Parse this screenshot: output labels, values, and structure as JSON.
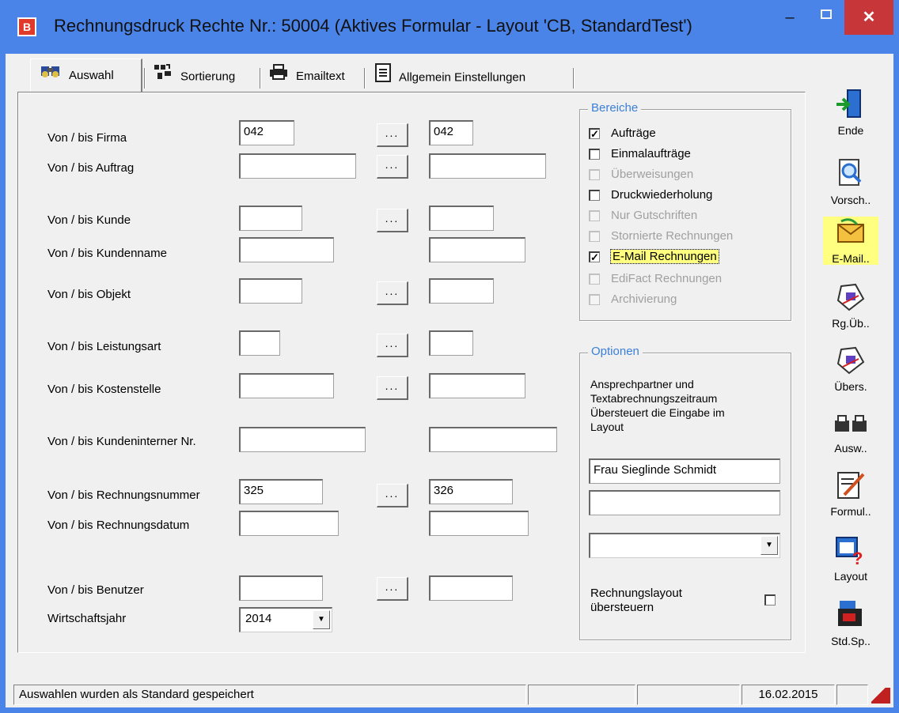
{
  "window": {
    "title": "Rechnungsdruck Rechte Nr.: 50004  (Aktives Formular - Layout 'CB, StandardTest')",
    "minimize": "–",
    "close": "✕"
  },
  "tabs": [
    {
      "label": "Auswahl",
      "icon": "binoculars-icon"
    },
    {
      "label": "Sortierung",
      "icon": "sort-icon"
    },
    {
      "label": "Emailtext",
      "icon": "printer-icon"
    },
    {
      "label": "Allgemein Einstellungen",
      "icon": "document-icon"
    }
  ],
  "form": {
    "firma": {
      "label": "Von / bis Firma",
      "from": "042",
      "to": "042"
    },
    "auftrag": {
      "label": "Von / bis Auftrag",
      "from": "",
      "to": ""
    },
    "kunde": {
      "label": "Von / bis Kunde",
      "from": "",
      "to": ""
    },
    "kundenname": {
      "label": "Von / bis Kundenname",
      "from": "",
      "to": ""
    },
    "objekt": {
      "label": "Von / bis Objekt",
      "from": "",
      "to": ""
    },
    "leistungsart": {
      "label": "Von / bis Leistungsart",
      "from": "",
      "to": ""
    },
    "kostenstelle": {
      "label": "Von / bis Kostenstelle",
      "from": "",
      "to": ""
    },
    "kundeninterner": {
      "label": "Von / bis Kundeninterner Nr.",
      "from": "",
      "to": ""
    },
    "rechnungsnummer": {
      "label": "Von / bis Rechnungsnummer",
      "from": "325",
      "to": "326"
    },
    "rechnungsdatum": {
      "label": "Von / bis Rechnungsdatum",
      "from": "",
      "to": ""
    },
    "benutzer": {
      "label": "Von / bis Benutzer",
      "from": "",
      "to": ""
    },
    "wirtschaftsjahr": {
      "label": "Wirtschaftsjahr",
      "value": "2014"
    },
    "dots_label": "..."
  },
  "bereiche": {
    "title": "Bereiche",
    "items": [
      {
        "label": "Aufträge",
        "checked": true,
        "enabled": true
      },
      {
        "label": "Einmalaufträge",
        "checked": false,
        "enabled": true
      },
      {
        "label": "Überweisungen",
        "checked": false,
        "enabled": false
      },
      {
        "label": "Druckwiederholung",
        "checked": false,
        "enabled": true
      },
      {
        "label": "Nur Gutschriften",
        "checked": false,
        "enabled": false
      },
      {
        "label": "Stornierte Rechnungen",
        "checked": false,
        "enabled": false
      },
      {
        "label": "E-Mail Rechnungen",
        "checked": true,
        "enabled": true
      },
      {
        "label": "EdiFact Rechnungen",
        "checked": false,
        "enabled": false
      },
      {
        "label": "Archivierung",
        "checked": false,
        "enabled": false
      }
    ],
    "check_mark": "✓"
  },
  "optionen": {
    "title": "Optionen",
    "description": [
      "Ansprechpartner und",
      "Textabrechnungszeitraum",
      "Übersteuert die Eingabe im",
      "Layout"
    ],
    "ansprechpartner": "Frau Sieglinde Schmidt",
    "zeitraum": "",
    "combo_value": "",
    "override_label": [
      "Rechnungslayout",
      "übersteuern"
    ]
  },
  "sidebar": [
    {
      "label": "Ende",
      "icon": "exit-door-icon"
    },
    {
      "label": "Vorsch..",
      "icon": "preview-magnifier-icon"
    },
    {
      "label": "E-Mail..",
      "icon": "email-envelope-icon",
      "highlight": true
    },
    {
      "label": "Rg.Üb..",
      "icon": "invoice-transfer-icon"
    },
    {
      "label": "Übers.",
      "icon": "overview-icon"
    },
    {
      "label": "Ausw..",
      "icon": "printers-icon"
    },
    {
      "label": "Formul..",
      "icon": "form-edit-icon"
    },
    {
      "label": "Layout",
      "icon": "layout-calendar-icon"
    },
    {
      "label": "Std.Sp..",
      "icon": "save-default-icon"
    }
  ],
  "statusbar": {
    "message": "Auswahlen wurden als Standard gespeichert",
    "date": "16.02.2015"
  },
  "colors": {
    "titlebar": "#4a84e8",
    "close": "#c7373a",
    "group_title": "#3b7fd8",
    "highlight": "#ffff80"
  }
}
